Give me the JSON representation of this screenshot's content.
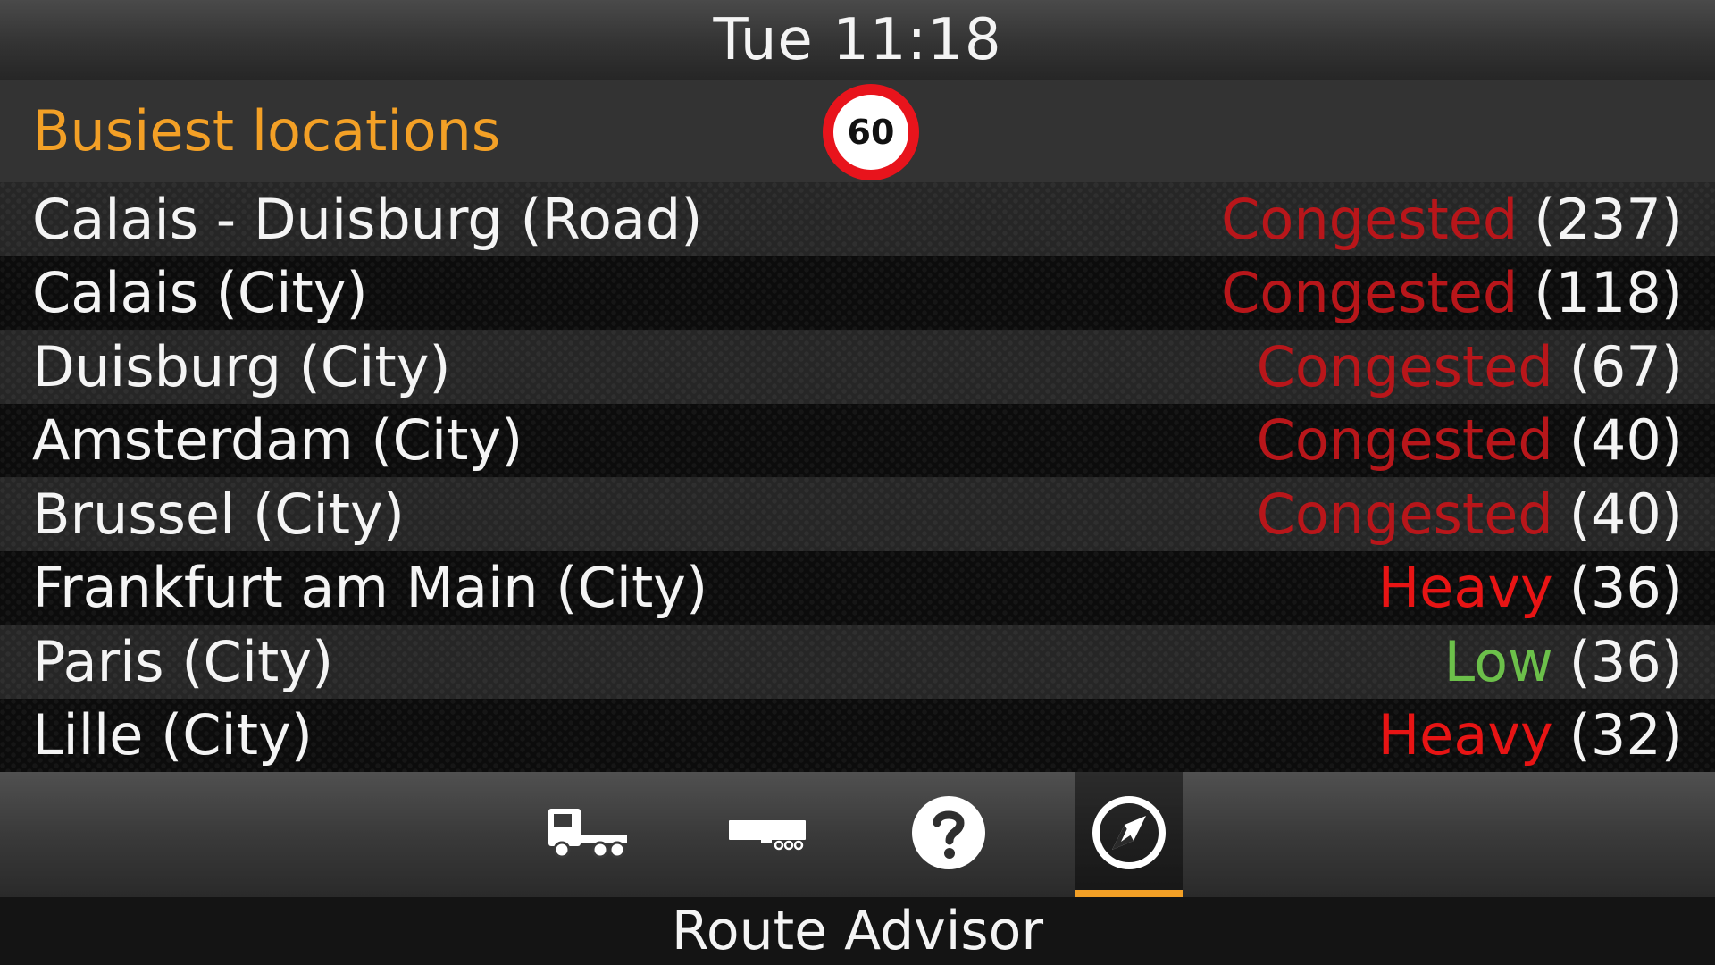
{
  "clock": "Tue 11:18",
  "header": {
    "title": "Busiest locations"
  },
  "speed_limit": "60",
  "locations": [
    {
      "name": "Calais - Duisburg (Road)",
      "status": "Congested",
      "count": "(237)"
    },
    {
      "name": "Calais (City)",
      "status": "Congested",
      "count": "(118)"
    },
    {
      "name": "Duisburg (City)",
      "status": "Congested",
      "count": "(67)"
    },
    {
      "name": "Amsterdam (City)",
      "status": "Congested",
      "count": "(40)"
    },
    {
      "name": "Brussel (City)",
      "status": "Congested",
      "count": "(40)"
    },
    {
      "name": "Frankfurt am Main (City)",
      "status": "Heavy",
      "count": "(36)"
    },
    {
      "name": "Paris (City)",
      "status": "Low",
      "count": "(36)"
    },
    {
      "name": "Lille (City)",
      "status": "Heavy",
      "count": "(32)"
    }
  ],
  "status_colors": {
    "Congested": "#b8161a",
    "Heavy": "#e81414",
    "Low": "#6cc04a"
  },
  "accent_color": "#f3a026",
  "nav": {
    "buttons": [
      {
        "icon": "truck-icon"
      },
      {
        "icon": "trailer-icon"
      },
      {
        "icon": "help-icon"
      },
      {
        "icon": "compass-icon",
        "active": true
      }
    ]
  },
  "footer": {
    "title": "Route Advisor"
  }
}
